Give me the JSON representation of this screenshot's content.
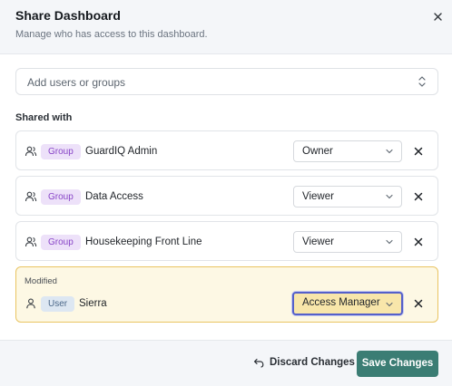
{
  "dialog": {
    "title": "Share Dashboard",
    "subtitle": "Manage who has access to this dashboard.",
    "close_icon": "close-icon"
  },
  "add_input": {
    "placeholder": "Add users or groups",
    "icon": "chevron-up-down-icon"
  },
  "shared_with": {
    "label": "Shared with",
    "entries": [
      {
        "type_badge": "Group",
        "name": "GuardIQ Admin",
        "role": "Owner",
        "modified": false
      },
      {
        "type_badge": "Group",
        "name": "Data Access",
        "role": "Viewer",
        "modified": false
      },
      {
        "type_badge": "Group",
        "name": "Housekeeping Front Line",
        "role": "Viewer",
        "modified": false
      },
      {
        "type_badge": "User",
        "name": "Sierra",
        "role": "Access Manager",
        "modified": true,
        "modified_label": "Modified"
      }
    ]
  },
  "footer": {
    "discard_label": "Discard Changes",
    "save_label": "Save Changes"
  },
  "colors": {
    "primary": "#3b7d74",
    "modified_bg": "#fdf8e4",
    "modified_border": "#e9c462",
    "group_badge": "#8845c7",
    "user_badge": "#4b6889",
    "focus_ring": "#5560c9"
  }
}
